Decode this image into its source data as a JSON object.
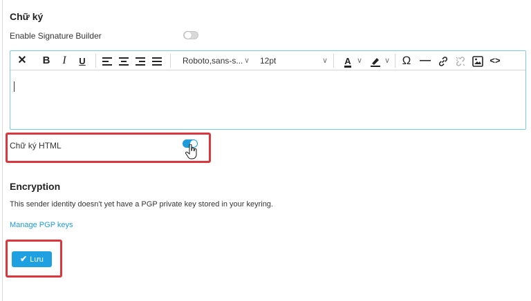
{
  "signature": {
    "title": "Chữ ký",
    "builder_label": "Enable Signature Builder",
    "builder_enabled": false,
    "html_label": "Chữ ký HTML",
    "html_enabled": true
  },
  "toolbar": {
    "font_family": "Roboto,sans-s...",
    "font_size": "12pt",
    "buttons": [
      "clear-formatting",
      "bold",
      "italic",
      "underline",
      "align-left",
      "align-center",
      "align-right",
      "justify",
      "font-family",
      "font-size",
      "text-color",
      "highlight-color",
      "special-character",
      "horizontal-line",
      "link",
      "unlink",
      "image",
      "source-code"
    ]
  },
  "encryption": {
    "title": "Encryption",
    "description": "This sender identity doesn't yet have a PGP private key stored in your keyring.",
    "manage_link": "Manage PGP keys"
  },
  "actions": {
    "save_label": "Lưu"
  },
  "colors": {
    "accent": "#1e9bdb",
    "highlight_border": "#d9363e",
    "editor_border": "#7dc6ea"
  }
}
